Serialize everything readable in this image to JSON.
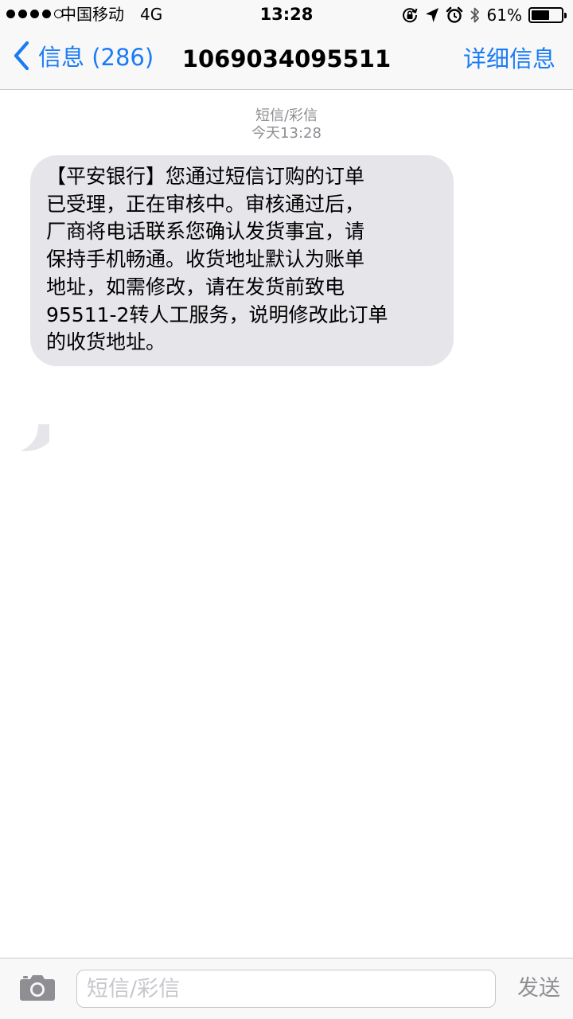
{
  "status_bar": {
    "carrier": "中国移动",
    "network": "4G",
    "time": "13:28",
    "battery_percent": "61%",
    "battery_level": 0.61,
    "signal_strength": 4,
    "signal_max": 5,
    "icons": [
      "orientation-lock-icon",
      "location-arrow-icon",
      "alarm-clock-icon",
      "bluetooth-icon",
      "battery-icon"
    ]
  },
  "nav": {
    "back_label": "信息 (286)",
    "title": "1069034095511",
    "details_label": "详细信息"
  },
  "conversation": {
    "message_type": "短信/彩信",
    "timestamp": "今天13:28",
    "messages": [
      {
        "direction": "incoming",
        "lines": [
          "【平安银行】您通过短信订购的订单",
          "已受理，正在审核中。审核通过后，",
          "厂商将电话联系您确认发货事宜，请",
          "保持手机畅通。收货地址默认为账单",
          "地址，如需修改，请在发货前致电",
          "95511-2转人工服务，说明修改此订单",
          "的收货地址。"
        ]
      }
    ]
  },
  "input_bar": {
    "camera_icon": "camera-icon",
    "placeholder": "短信/彩信",
    "value": "",
    "send_label": "发送"
  },
  "colors": {
    "accent": "#1a7cf5",
    "bar_background": "#f8f8f8",
    "incoming_bubble": "#e5e5ea",
    "secondary_text": "#8e8e93",
    "separator": "#c8c8cc"
  }
}
